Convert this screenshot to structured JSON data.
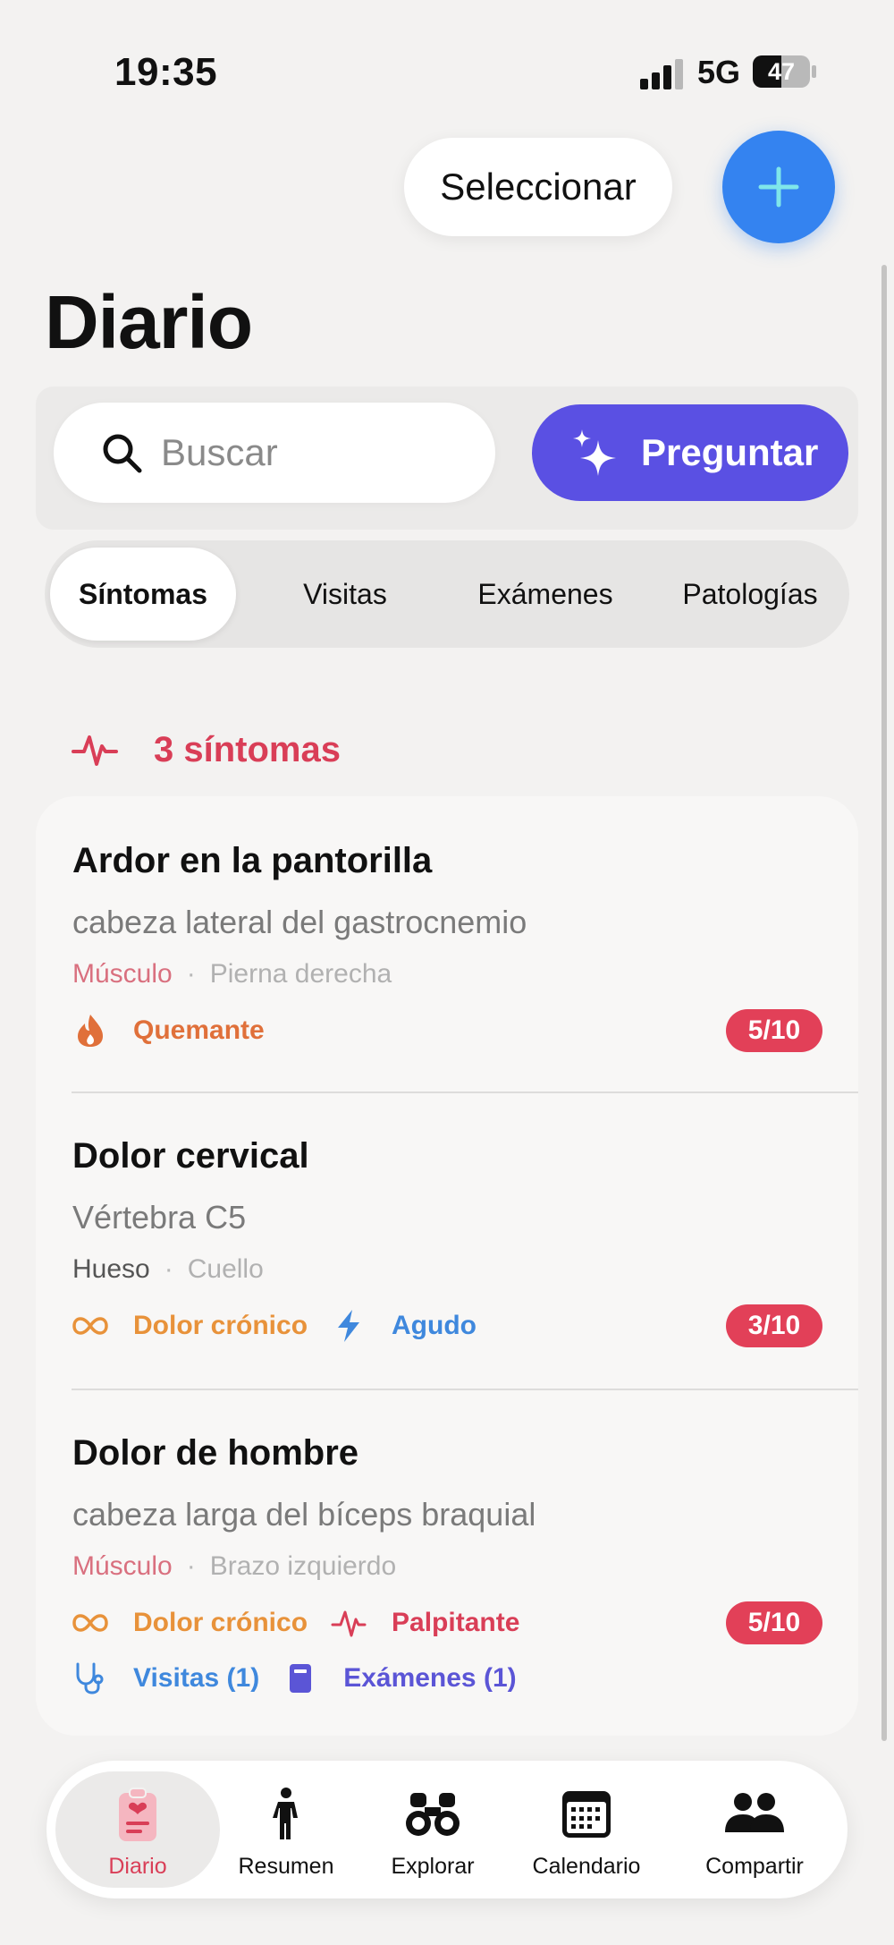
{
  "status_bar": {
    "time": "19:35",
    "network": "5G",
    "battery": "47"
  },
  "header": {
    "select_label": "Seleccionar",
    "title": "Diario"
  },
  "search": {
    "placeholder": "Buscar",
    "ask_label": "Preguntar"
  },
  "segments": [
    {
      "label": "Síntomas",
      "active": true
    },
    {
      "label": "Visitas",
      "active": false
    },
    {
      "label": "Exámenes",
      "active": false
    },
    {
      "label": "Patologías",
      "active": false
    }
  ],
  "symptoms": {
    "count_label": "3 síntomas",
    "items": [
      {
        "title": "Ardor en la pantorilla",
        "subtitle": "cabeza lateral del gastrocnemio",
        "category": "Músculo",
        "location": "Pierna derecha",
        "tag1": "Quemante",
        "severity": "5/10"
      },
      {
        "title": "Dolor cervical",
        "subtitle": "Vértebra C5",
        "category": "Hueso",
        "location": "Cuello",
        "tag1": "Dolor crónico",
        "tag2": "Agudo",
        "severity": "3/10"
      },
      {
        "title": "Dolor de hombre",
        "subtitle": "cabeza larga del bíceps braquial",
        "category": "Músculo",
        "location": "Brazo izquierdo",
        "tag1": "Dolor crónico",
        "tag2": "Palpitante",
        "visits": "Visitas (1)",
        "exams": "Exámenes (1)",
        "severity": "5/10"
      }
    ]
  },
  "tab_bar": {
    "items": [
      {
        "label": "Diario",
        "icon": "clipboard-heart-icon",
        "active": true
      },
      {
        "label": "Resumen",
        "icon": "person-icon",
        "active": false
      },
      {
        "label": "Explorar",
        "icon": "binoculars-icon",
        "active": false
      },
      {
        "label": "Calendario",
        "icon": "calendar-icon",
        "active": false
      },
      {
        "label": "Compartir",
        "icon": "people-icon",
        "active": false
      }
    ]
  },
  "colors": {
    "accent_blue": "#3483f0",
    "ask_purple": "#5a50e3",
    "symptom_red": "#d93e57",
    "severity_red": "#e24058",
    "muscle_pink": "#d9707f",
    "burn_orange": "#e0703a",
    "chronic_orange": "#e8923a",
    "acute_blue": "#3f88dd",
    "visit_blue": "#3f88dd",
    "exam_purple": "#5b55d6"
  }
}
